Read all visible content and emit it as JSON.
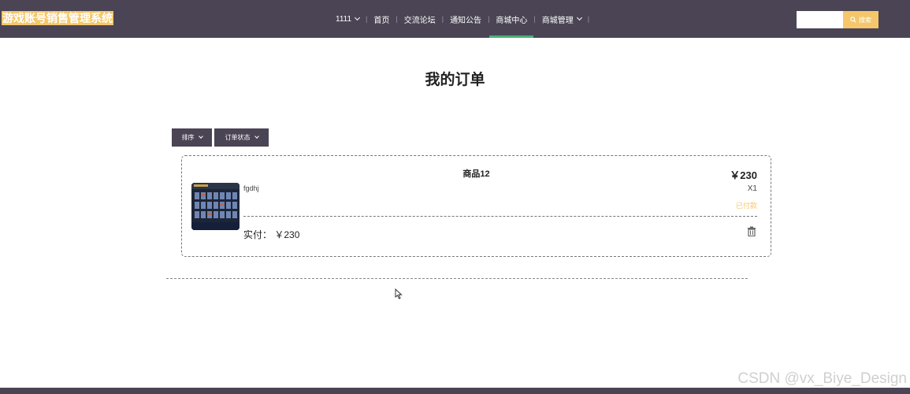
{
  "app": {
    "title": "游戏账号销售管理系统"
  },
  "nav": {
    "items": [
      {
        "label": "1111",
        "dropdown": true,
        "active": false
      },
      {
        "label": "首页",
        "dropdown": false,
        "active": false
      },
      {
        "label": "交流论坛",
        "dropdown": false,
        "active": false
      },
      {
        "label": "通知公告",
        "dropdown": false,
        "active": false
      },
      {
        "label": "商城中心",
        "dropdown": false,
        "active": true
      },
      {
        "label": "商城管理",
        "dropdown": true,
        "active": false
      }
    ],
    "separator": "|"
  },
  "search": {
    "value": "",
    "button_label": "搜索"
  },
  "page": {
    "title": "我的订单"
  },
  "filters": {
    "sort_label": "排序",
    "status_label": "订单状态"
  },
  "order": {
    "product_name": "商品12",
    "price": "￥230",
    "description": "fgdhj",
    "quantity": "X1",
    "status": "已付款",
    "paid_label": "实付：",
    "paid_amount": "￥230"
  },
  "watermark": "CSDN @vx_Biye_Design",
  "colors": {
    "header": "#4a4454",
    "accent": "#f5c76a",
    "active_underline": "#4caf7a"
  },
  "icons": {
    "search": "search-icon",
    "delete": "trash-icon",
    "dropdown": "chevron-down-icon"
  }
}
